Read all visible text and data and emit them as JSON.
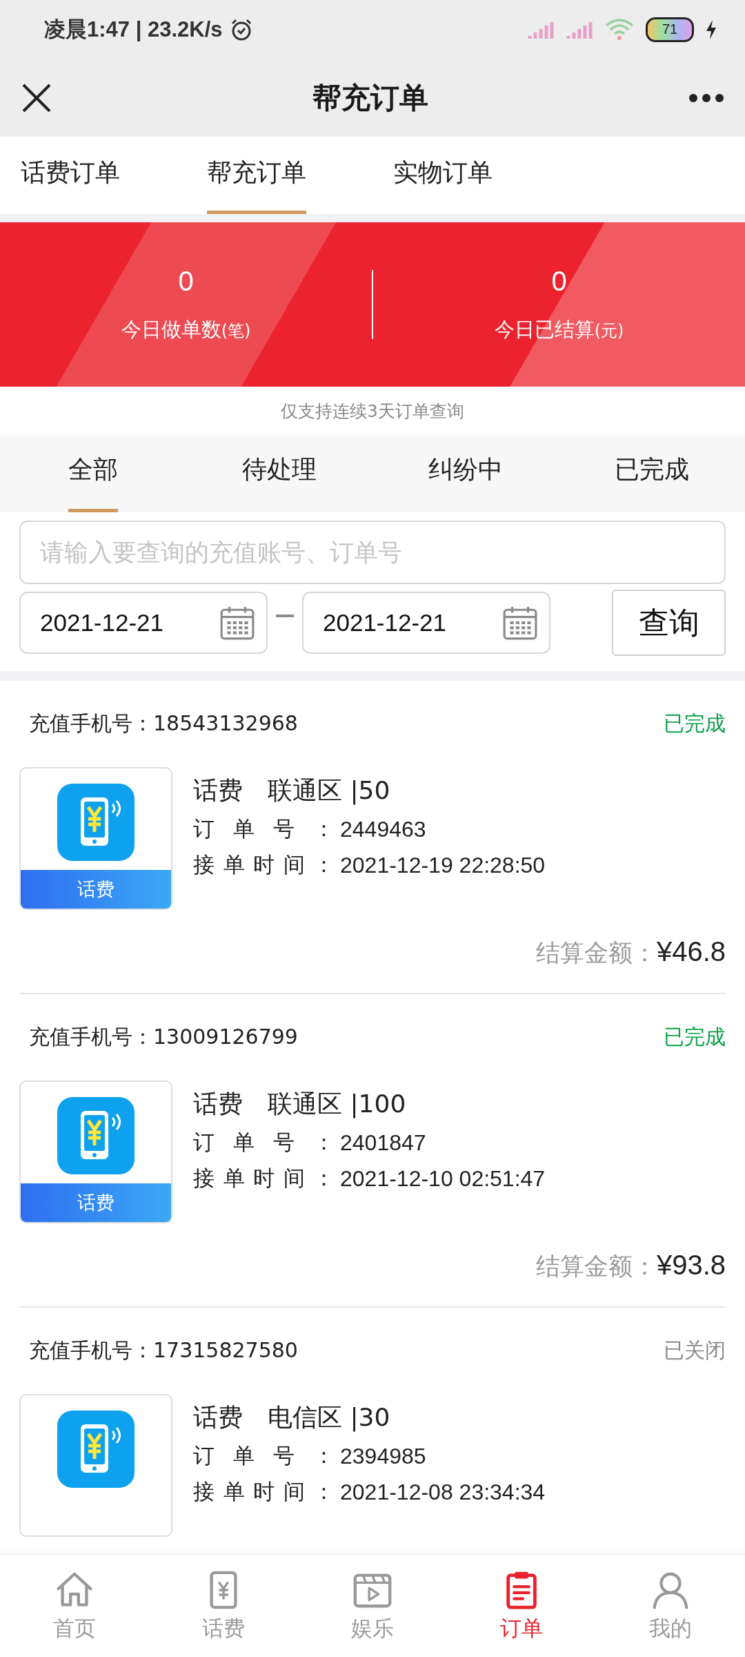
{
  "status_bar": {
    "time": "凌晨1:47 | 23.2K/s",
    "battery": "71"
  },
  "header": {
    "title": "帮充订单"
  },
  "order_tabs": [
    {
      "label": "话费订单",
      "selected": false
    },
    {
      "label": "帮充订单",
      "selected": true
    },
    {
      "label": "实物订单",
      "selected": false
    }
  ],
  "summary": [
    {
      "value": "0",
      "label": "今日做单数",
      "unit": "(笔)"
    },
    {
      "value": "0",
      "label": "今日已结算",
      "unit": "(元)"
    }
  ],
  "notice": "仅支持连续3天订单查询",
  "status_tabs": [
    {
      "label": "全部",
      "selected": true
    },
    {
      "label": "待处理",
      "selected": false
    },
    {
      "label": "纠纷中",
      "selected": false
    },
    {
      "label": "已完成",
      "selected": false
    }
  ],
  "search": {
    "placeholder": "请输入要查询的充值账号、订单号"
  },
  "date_from": "2021-12-21",
  "date_to": "2021-12-21",
  "query_button": "查询",
  "orders": [
    {
      "phone": "充值手机号：18543132968",
      "status": "已完成",
      "kind": "done",
      "badge": "话费",
      "category": "话费",
      "product": "联通区 |50",
      "order_no_label": "订单号：",
      "order_no": "2449463",
      "time_label": "接单时间：",
      "time": "2021-12-19 22:28:50",
      "amount_label": "结算金额：",
      "amount": "¥46.8"
    },
    {
      "phone": "充值手机号：13009126799",
      "status": "已完成",
      "kind": "done",
      "badge": "话费",
      "category": "话费",
      "product": "联通区 |100",
      "order_no_label": "订单号：",
      "order_no": "2401847",
      "time_label": "接单时间：",
      "time": "2021-12-10 02:51:47",
      "amount_label": "结算金额：",
      "amount": "¥93.8"
    },
    {
      "phone": "充值手机号：17315827580",
      "status": "已关闭",
      "kind": "closed",
      "category": "话费",
      "product": "电信区 |30",
      "order_no_label": "订单号：",
      "order_no": "2394985",
      "time_label": "接单时间：",
      "time": "2021-12-08 23:34:34"
    }
  ],
  "tab_bar": [
    {
      "label": "首页",
      "selected": false
    },
    {
      "label": "话费",
      "selected": false
    },
    {
      "label": "娱乐",
      "selected": false
    },
    {
      "label": "订单",
      "selected": true
    },
    {
      "label": "我的",
      "selected": false
    }
  ]
}
